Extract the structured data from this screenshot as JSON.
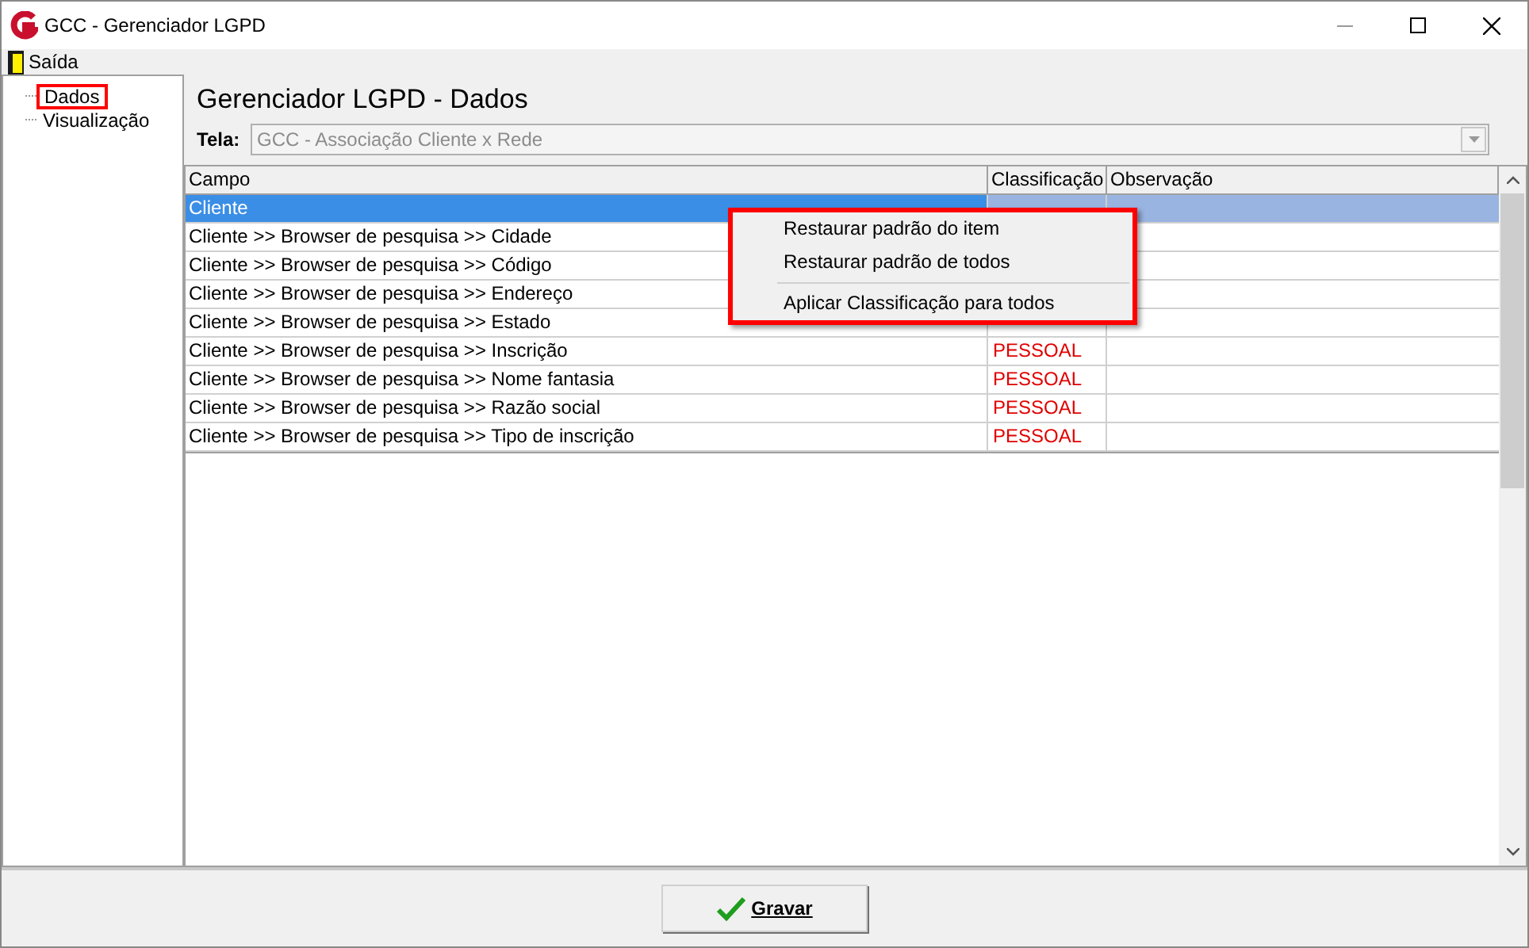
{
  "window": {
    "title": "GCC - Gerenciador LGPD"
  },
  "menu": [
    {
      "label": "Saída"
    }
  ],
  "tree": [
    {
      "label": "Dados",
      "highlighted": true
    },
    {
      "label": "Visualização",
      "highlighted": false
    }
  ],
  "heading": "Gerenciador LGPD - Dados",
  "screen_field": {
    "label": "Tela:",
    "value": "GCC - Associação Cliente x Rede"
  },
  "table": {
    "columns": [
      "Campo",
      "Classificação",
      "Observação"
    ],
    "rows": [
      {
        "campo": "Cliente",
        "selected": true
      },
      {
        "campo": "Cliente >> Browser de pesquisa >> Cidade",
        "selected": false
      },
      {
        "campo": "Cliente >> Browser de pesquisa >> Código",
        "selected": false
      },
      {
        "campo": "Cliente >> Browser de pesquisa >> Endereço",
        "selected": false
      },
      {
        "campo": "Cliente >> Browser de pesquisa >> Estado",
        "selected": false
      },
      {
        "campo": "Cliente >> Browser de pesquisa >> Inscrição",
        "classificacao": "PESSOAL",
        "selected": false
      },
      {
        "campo": "Cliente >> Browser de pesquisa >> Nome fantasia",
        "classificacao": "PESSOAL",
        "selected": false
      },
      {
        "campo": "Cliente >> Browser de pesquisa >> Razão social",
        "classificacao": "PESSOAL",
        "selected": false
      },
      {
        "campo": "Cliente >> Browser de pesquisa >> Tipo de inscrição",
        "classificacao": "PESSOAL",
        "selected": false
      }
    ]
  },
  "context_menu": {
    "items": [
      {
        "kind": "item",
        "label": "Restaurar padrão do item"
      },
      {
        "kind": "item",
        "label": "Restaurar padrão de todos"
      },
      {
        "kind": "separator"
      },
      {
        "kind": "item",
        "label": "Aplicar Classificação para todos"
      }
    ]
  },
  "save_button": {
    "label": "Gravar"
  }
}
